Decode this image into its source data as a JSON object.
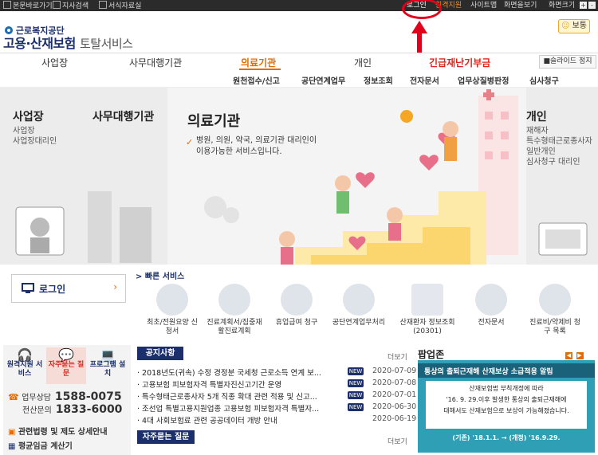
{
  "topbar": {
    "left_links": [
      "본문바로가기",
      "지사검색",
      "서식자료실"
    ],
    "right_links": [
      "로그인",
      "원격지원",
      "사이트맵",
      "화면을보기"
    ],
    "font_size_label": "화면크기",
    "font_plus": "+",
    "font_minus": "-"
  },
  "header": {
    "agency": "근로복지공단",
    "title": "고용·산재보험",
    "title_suffix": "토탈서비스",
    "badge": "보통"
  },
  "gnb": {
    "items": [
      "사업장",
      "사무대행기관",
      "의료기관",
      "개인",
      "긴급재난기부금"
    ],
    "slide_stop": "■슬라이드 정지"
  },
  "subnav": {
    "items": [
      "원천접수/신고",
      "공단연계업무",
      "정보조회",
      "전자문서",
      "업무상질병판정",
      "심사청구"
    ]
  },
  "hero": {
    "left_title_1": "사업장",
    "left_title_2": "사무대행기관",
    "left_sub": [
      "사업장",
      "사업장대리인"
    ],
    "main_title": "의료기관",
    "check": "✓",
    "main_desc": [
      "병원, 의원, 약국, 의료기관 대리인이",
      "이용가능한 서비스입니다."
    ],
    "right_title": "개인",
    "right_sub": [
      "재해자",
      "특수형태근로종사자",
      "일반개인",
      "심사청구 대리인"
    ]
  },
  "login": {
    "label": "로그인",
    "arrow": "›"
  },
  "quick": {
    "title": "> 빠른 서비스",
    "items": [
      {
        "label": "최초/전원요양 신청서"
      },
      {
        "label": "진료계획서/집중재활진료계획"
      },
      {
        "label": "휴업급여 청구"
      },
      {
        "label": "공단연계업무처리"
      },
      {
        "label": "산재환자 정보조회(20301)"
      },
      {
        "label": "전자문서"
      },
      {
        "label": "진료비/약제비 청구 목록"
      }
    ]
  },
  "contacts": {
    "remote": "원격지원 서비스",
    "faq": "자주묻는 질문",
    "program": "프로그램 설치",
    "consult_label": "업무상담",
    "consult_number": "1588-0075",
    "call_label": "전산문의",
    "call_number": "1833-6000",
    "law": "관련법령 및 제도 상세안내",
    "wage": "평균임금 계산기"
  },
  "notices": {
    "tab": "공지사항",
    "more": "더보기",
    "new_label": "NEW",
    "rows": [
      {
        "title": "2018년도(귀속) 수정 경정분 국세청 근로소득 연계 보...",
        "date": "2020-07-09",
        "new": true
      },
      {
        "title": "고용보험 피보험자격 특별자진신고기간 운영",
        "date": "2020-07-08",
        "new": true
      },
      {
        "title": "특수형태근로종사자 5개 직종 확대 관련 적용 및 신고...",
        "date": "2020-07-01",
        "new": true
      },
      {
        "title": "조선업 특별고용지원업종 고용보험 피보험자격 특별자...",
        "date": "2020-06-30",
        "new": true
      },
      {
        "title": "4대 사회보험료 관련 공공데이터 개방 안내",
        "date": "2020-06-19",
        "new": false
      }
    ]
  },
  "faq": {
    "tab": "자주묻는 질문",
    "more": "더보기"
  },
  "popup": {
    "title": "팝업존",
    "ctrl_prev": "◀",
    "ctrl_next": "▶",
    "banner_header": "통상의 출퇴근재해 산재보상 소급적용 알림",
    "banner_line1": "산재보험법 부칙개정에 따라",
    "banner_line2": "'16. 9. 29.이후 발생한 통상의 출퇴근재해에",
    "banner_line3": "대해서도 산재보험으로 보상이 가능해졌습니다.",
    "banner_date": "(기존) '18.1.1. → (개정) '16.9.29."
  },
  "colors": {
    "brand": "#1b2f6b",
    "accent": "#e36b00",
    "annotation": "#e2001a"
  }
}
